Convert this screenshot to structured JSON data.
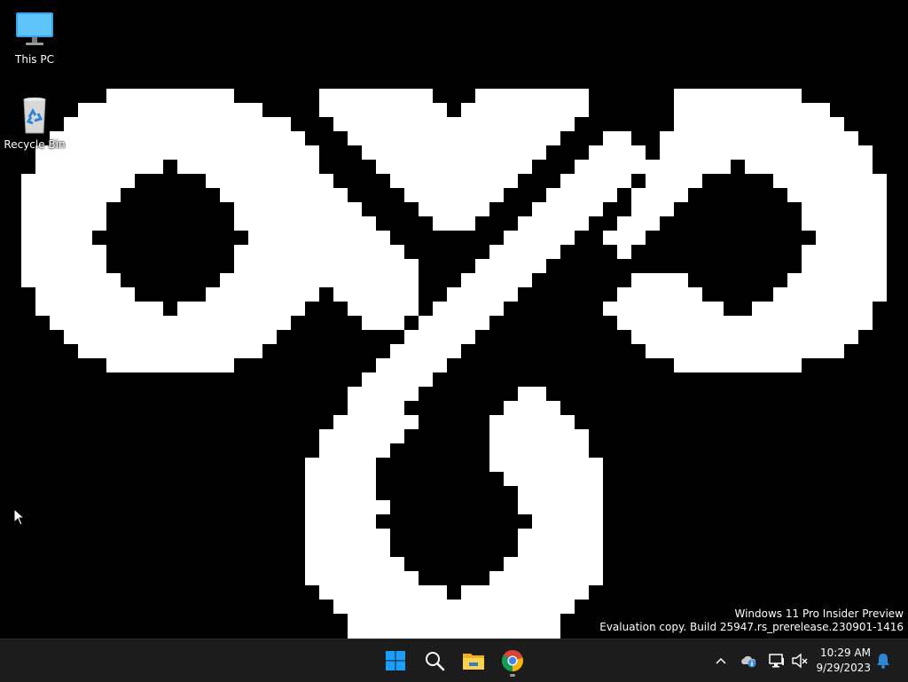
{
  "desktop": {
    "icons": [
      {
        "label": "This PC",
        "icon": "this-pc-icon"
      },
      {
        "label": "Recycle Bin",
        "icon": "recycle-bin-icon"
      }
    ],
    "watermark": {
      "line1": "Windows 11 Pro Insider Preview",
      "line2": "Evaluation copy. Build 25947.rs_prerelease.230901-1416"
    },
    "wallpaper": {
      "icon": "pixel-knot-logo",
      "colors": {
        "background": "#000000",
        "shape": "#ffffff"
      }
    }
  },
  "taskbar": {
    "pinned": [
      {
        "name": "Start",
        "icon": "windows-start-icon"
      },
      {
        "name": "Search",
        "icon": "search-icon"
      },
      {
        "name": "File Explorer",
        "icon": "file-explorer-icon"
      },
      {
        "name": "Google Chrome",
        "icon": "chrome-icon",
        "running": true
      }
    ],
    "tray": [
      {
        "icon": "chevron-up-icon"
      },
      {
        "icon": "onedrive-info-icon"
      },
      {
        "icon": "network-icon"
      },
      {
        "icon": "speaker-muted-icon"
      }
    ],
    "clock": {
      "time": "10:29 AM",
      "date": "9/29/2023"
    },
    "notifications": {
      "icon": "notification-bell-icon"
    },
    "colors": {
      "background": "#1c1c1c",
      "accent": "#0078d4"
    }
  }
}
